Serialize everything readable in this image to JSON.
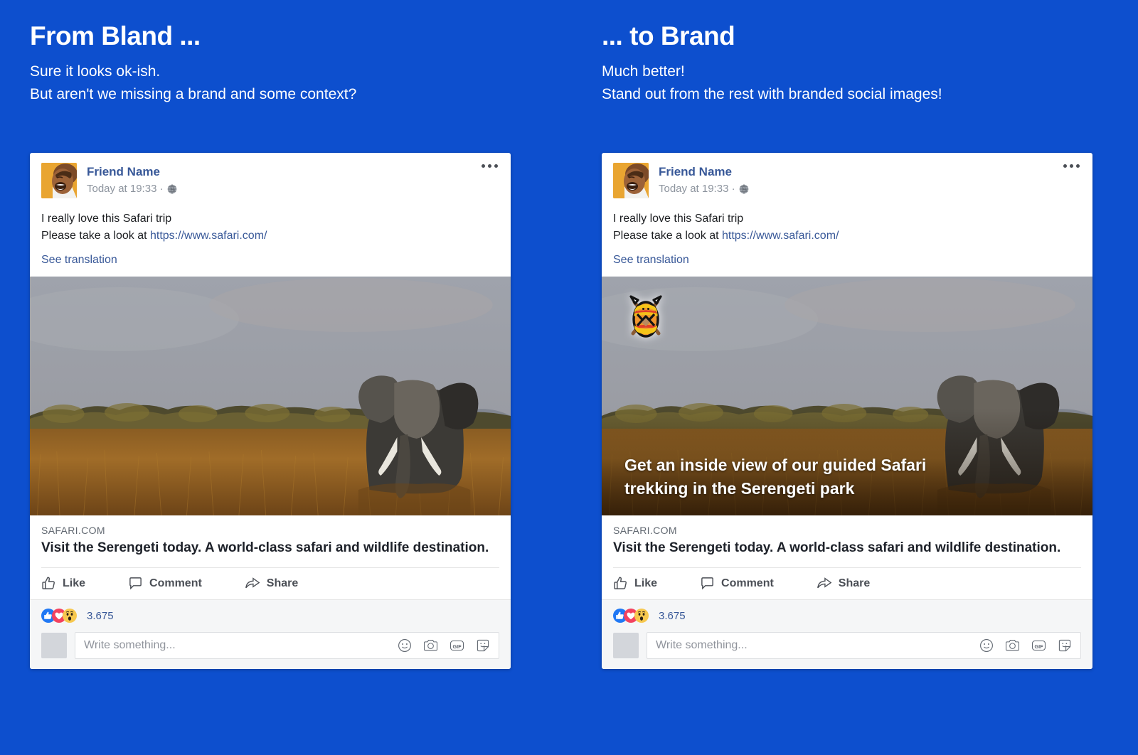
{
  "background_color": "#0d4fce",
  "columns": [
    {
      "title": "From Bland ...",
      "sub_line1": "Sure it looks ok-ish.",
      "sub_line2": "But aren't we missing a brand and some context?",
      "branded": false
    },
    {
      "title": "... to Brand",
      "sub_line1": "Much better!",
      "sub_line2": "Stand out from the rest with branded social images!",
      "branded": true
    }
  ],
  "post": {
    "author": "Friend Name",
    "timestamp": "Today at 19:33 ·",
    "privacy_icon": "globe-icon",
    "more_icon": "more-options-icon",
    "text_line1": "I really love this Safari trip",
    "text_line2_prefix": "Please take a look at ",
    "text_link": "https://www.safari.com/",
    "see_translation": "See translation",
    "image_alt": "elephant-savanna-photo",
    "overlay_caption_line1": "Get an inside view of our guided Safari",
    "overlay_caption_line2": "trekking in the Serengeti park",
    "brand_logo_name": "safari-shield-spears-logo",
    "link_preview": {
      "domain": "SAFARI.COM",
      "title": "Visit the Serengeti today. A world-class safari and wildlife destination."
    },
    "actions": [
      {
        "label": "Like",
        "icon": "thumbs-up-icon"
      },
      {
        "label": "Comment",
        "icon": "speech-bubble-icon"
      },
      {
        "label": "Share",
        "icon": "share-arrow-icon"
      }
    ],
    "reactions": {
      "icons": [
        "like-reaction-icon",
        "love-reaction-icon",
        "wow-reaction-icon"
      ],
      "count": "3.675"
    },
    "comment_box": {
      "placeholder": "Write something...",
      "icons": [
        "emoji-icon",
        "camera-icon",
        "gif-icon",
        "sticker-icon"
      ]
    }
  },
  "colors": {
    "accent_blue": "#0d4fce",
    "fb_link": "#385898",
    "meta_gray": "#8d949e",
    "logo_orange": "#f0962e",
    "logo_yellow": "#f5c518",
    "logo_red": "#e0402a"
  }
}
